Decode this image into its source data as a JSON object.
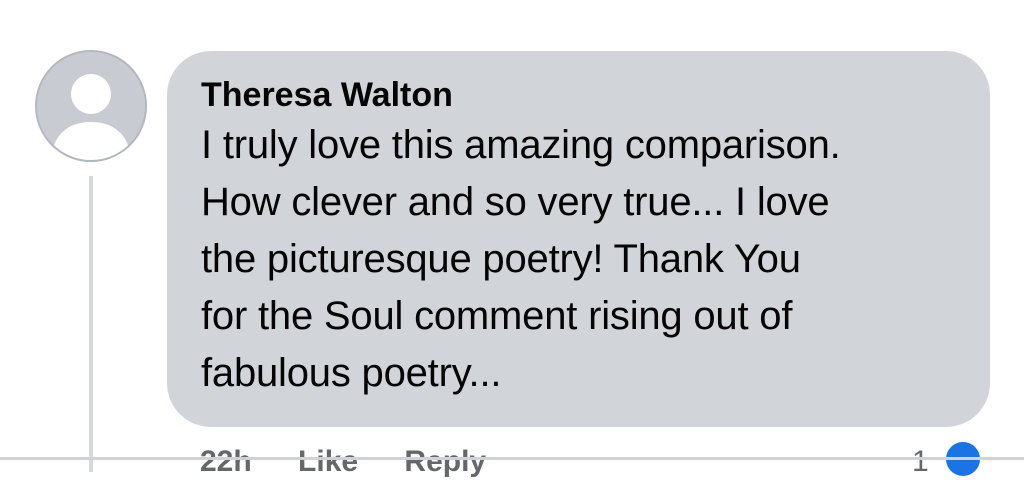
{
  "comment": {
    "author": "Theresa Walton",
    "text": "I truly love this amazing comparison.\nHow clever and so very true... I love\nthe picturesque poetry!  Thank You\nfor the Soul comment rising out of\nfabulous poetry...",
    "time": "22h",
    "like_label": "Like",
    "reply_label": "Reply",
    "reaction_count": "1"
  },
  "avatar": {
    "icon": "default-user-avatar-icon"
  },
  "reaction": {
    "icon": "like-thumb-icon",
    "color": "#1b74e4"
  },
  "colors": {
    "bubble": "#d1d4d9",
    "text": "#050505",
    "meta": "#65676b"
  }
}
